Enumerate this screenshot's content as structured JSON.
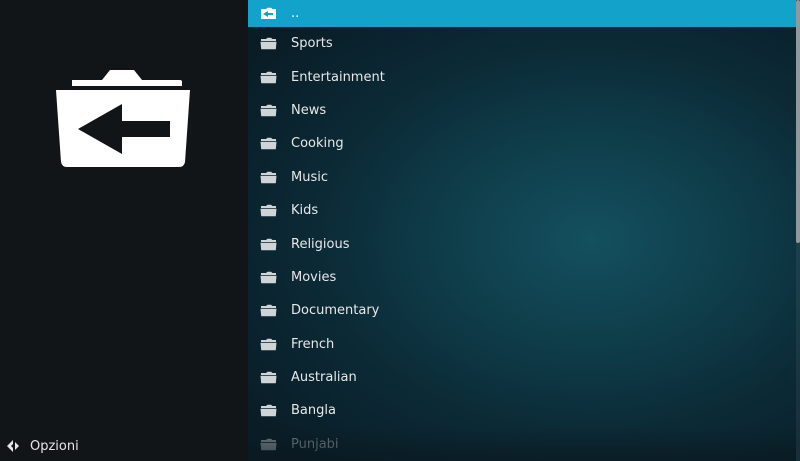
{
  "sidebar": {
    "big_icon": "folder-back-icon",
    "options_label": "Opzioni",
    "options_icon": "options-arrow-icon"
  },
  "list": {
    "items": [
      {
        "label": "..",
        "icon": "folder-back-icon",
        "selected": true
      },
      {
        "label": "Sports",
        "icon": "folder-icon"
      },
      {
        "label": "Entertainment",
        "icon": "folder-icon"
      },
      {
        "label": "News",
        "icon": "folder-icon"
      },
      {
        "label": "Cooking",
        "icon": "folder-icon"
      },
      {
        "label": "Music",
        "icon": "folder-icon"
      },
      {
        "label": "Kids",
        "icon": "folder-icon"
      },
      {
        "label": "Religious",
        "icon": "folder-icon"
      },
      {
        "label": "Movies",
        "icon": "folder-icon"
      },
      {
        "label": "Documentary",
        "icon": "folder-icon"
      },
      {
        "label": "French",
        "icon": "folder-icon"
      },
      {
        "label": "Australian",
        "icon": "folder-icon"
      },
      {
        "label": "Bangla",
        "icon": "folder-icon"
      },
      {
        "label": "Punjabi",
        "icon": "folder-icon"
      }
    ]
  },
  "colors": {
    "accent": "#13a2c9",
    "text": "#e8e8e8"
  }
}
